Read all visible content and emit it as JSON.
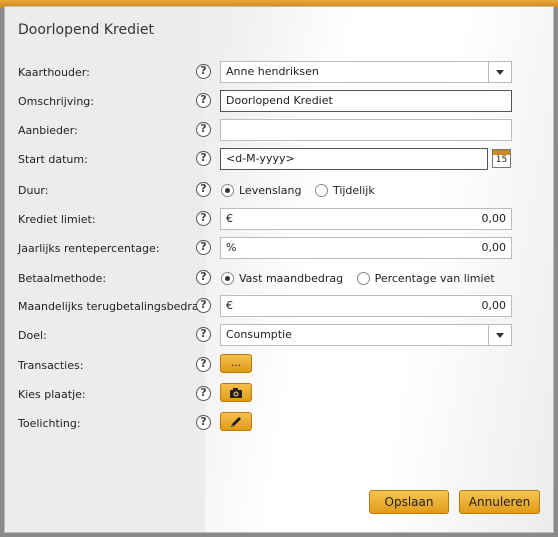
{
  "dialog": {
    "title": "Doorlopend Krediet"
  },
  "fields": {
    "kaarthouder": {
      "label": "Kaarthouder:",
      "value": "Anne hendriksen"
    },
    "omschrijving": {
      "label": "Omschrijving:",
      "value": "Doorlopend Krediet"
    },
    "aanbieder": {
      "label": "Aanbieder:",
      "value": ""
    },
    "start_datum": {
      "label": "Start datum:",
      "placeholder": "<d-M-yyyy>",
      "calendar_day": "15"
    },
    "duur": {
      "label": "Duur:",
      "options": [
        "Levenslang",
        "Tijdelijk"
      ],
      "selected": "Levenslang"
    },
    "krediet_limiet": {
      "label": "Krediet limiet:",
      "prefix": "€",
      "value": "0,00"
    },
    "rentepercentage": {
      "label": "Jaarlijks rentepercentage:",
      "prefix": "%",
      "value": "0,00"
    },
    "betaalmethode": {
      "label": "Betaalmethode:",
      "options": [
        "Vast maandbedrag",
        "Percentage van limiet"
      ],
      "selected": "Vast maandbedrag"
    },
    "terugbetaling": {
      "label": "Maandelijks terugbetalingsbedrag:",
      "prefix": "€",
      "value": "0,00"
    },
    "doel": {
      "label": "Doel:",
      "value": "Consumptie"
    },
    "transacties": {
      "label": "Transacties:",
      "button": "..."
    },
    "plaatje": {
      "label": "Kies plaatje:",
      "icon": "camera-icon"
    },
    "toelichting": {
      "label": "Toelichting:",
      "icon": "pencil-icon"
    }
  },
  "help_symbol": "?",
  "footer": {
    "save_label": "Opslaan",
    "cancel_label": "Annuleren"
  },
  "colors": {
    "accent": "#e8a328",
    "border": "#bcbcbc"
  }
}
